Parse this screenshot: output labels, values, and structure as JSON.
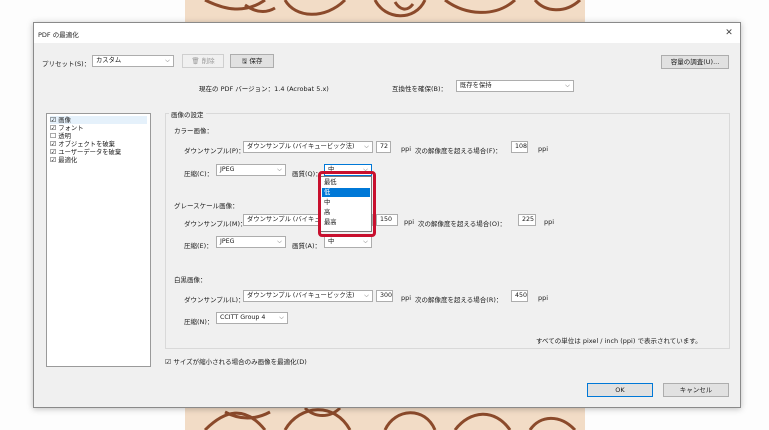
{
  "window": {
    "title": "PDF の最適化"
  },
  "toolbar": {
    "preset_label": "プリセット(S)：",
    "preset_value": "カスタム",
    "delete_label": "削除",
    "save_label": "保存",
    "audit_label": "容量の調査(U)..."
  },
  "version": {
    "current_text": "現在の PDF バージョン：1.4 (Acrobat 5.x)",
    "compat_label": "互換性を確保(B)：",
    "compat_value": "既存を保持"
  },
  "sidebar": {
    "items": [
      {
        "check": "☑",
        "label": "画像"
      },
      {
        "check": "☑",
        "label": "フォント"
      },
      {
        "check": "☐",
        "label": "透明"
      },
      {
        "check": "☑",
        "label": "オブジェクトを破棄"
      },
      {
        "check": "☑",
        "label": "ユーザーデータを破棄"
      },
      {
        "check": "☑",
        "label": "最適化"
      }
    ]
  },
  "image_settings": {
    "group_title": "画像の設定",
    "color": {
      "heading": "カラー画像：",
      "downsample_label": "ダウンサンプル(P)：",
      "downsample_value": "ダウンサンプル (バイキュービック法)",
      "ppi_value": "72",
      "ppi_unit": "ppi",
      "threshold_label": "次の解像度を超える場合(F)：",
      "threshold_value": "108",
      "threshold_unit": "ppi",
      "compress_label": "圧縮(C)：",
      "compress_value": "JPEG",
      "quality_label": "画質(Q)：",
      "quality_value": "中"
    },
    "gray": {
      "heading": "グレースケール画像：",
      "downsample_label": "ダウンサンプル(M)：",
      "downsample_value": "ダウンサンプル (バイキュー",
      "ppi_value": "150",
      "ppi_unit": "ppi",
      "threshold_label": "次の解像度を超える場合(O)：",
      "threshold_value": "225",
      "threshold_unit": "ppi",
      "compress_label": "圧縮(E)：",
      "compress_value": "JPEG",
      "quality_label": "画質(A)：",
      "quality_value": "中"
    },
    "mono": {
      "heading": "白黒画像：",
      "downsample_label": "ダウンサンプル(L)：",
      "downsample_value": "ダウンサンプル (バイキュービック法)",
      "ppi_value": "300",
      "ppi_unit": "ppi",
      "threshold_label": "次の解像度を超える場合(R)：",
      "threshold_value": "450",
      "threshold_unit": "ppi",
      "compress_label": "圧縮(N)：",
      "compress_value": "CCITT Group 4"
    },
    "units_note": "すべての単位は pixel / inch (ppi) で表示されています。"
  },
  "quality_dropdown": {
    "options": [
      "最低",
      "低",
      "中",
      "高",
      "最高"
    ],
    "selected_index": 1
  },
  "footer": {
    "optimize_checkbox": "☑",
    "optimize_label": "サイズが縮小される場合のみ画像を最適化(D)",
    "ok_label": "OK",
    "cancel_label": "キャンセル"
  },
  "colors": {
    "highlight": "#c8102e",
    "selection": "#0078d7",
    "art_bg": "#f2dcc6",
    "art_line": "#8b4a2b"
  }
}
